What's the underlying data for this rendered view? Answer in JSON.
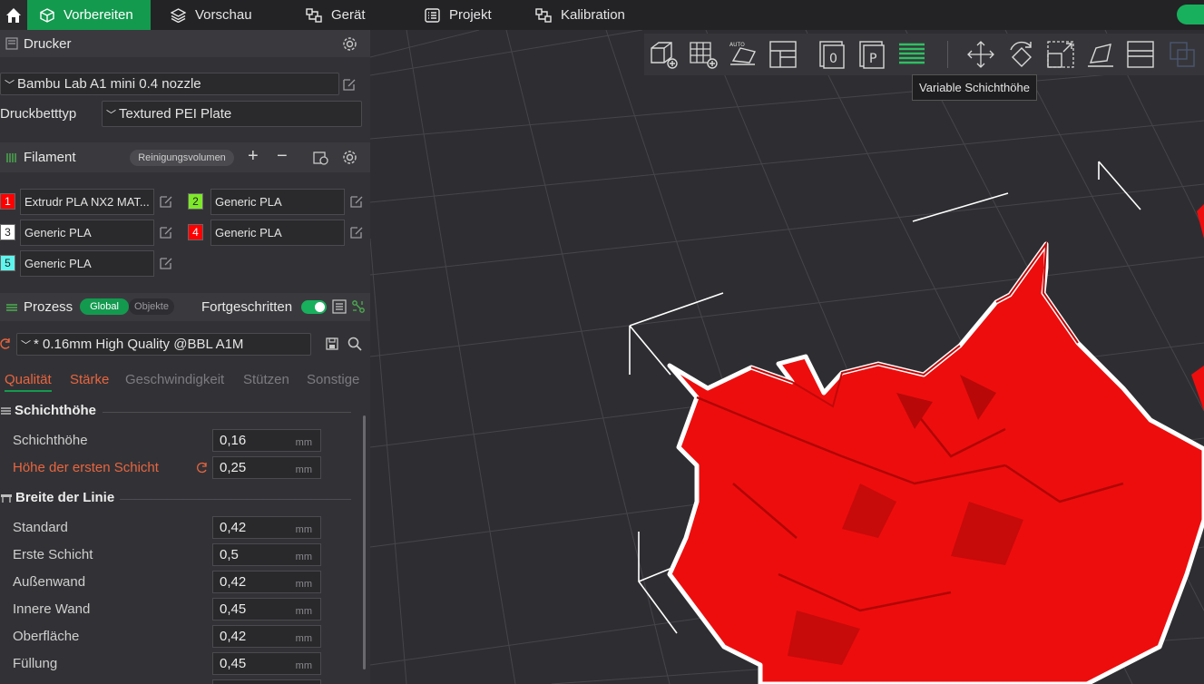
{
  "nav": {
    "tabs": [
      {
        "label": "Vorbereiten"
      },
      {
        "label": "Vorschau"
      },
      {
        "label": "Gerät"
      },
      {
        "label": "Projekt"
      },
      {
        "label": "Kalibration"
      }
    ]
  },
  "printer": {
    "title": "Drucker",
    "model": "Bambu Lab A1 mini 0.4 nozzle",
    "bed_label": "Druckbetttyp",
    "bed_value": "Textured PEI Plate"
  },
  "filament": {
    "title": "Filament",
    "purge_button": "Reinigungsvolumen",
    "add": "+",
    "remove": "−",
    "items": [
      {
        "num": "1",
        "name": "Extrudr PLA NX2 MAT...",
        "color": "#ff0000"
      },
      {
        "num": "2",
        "name": "Generic PLA",
        "color": "#7ee82a"
      },
      {
        "num": "3",
        "name": "Generic PLA",
        "color": "#ffffff"
      },
      {
        "num": "4",
        "name": "Generic PLA",
        "color": "#ff0000"
      },
      {
        "num": "5",
        "name": "Generic PLA",
        "color": "#5ff5ef"
      }
    ]
  },
  "process": {
    "title": "Prozess",
    "global": "Global",
    "objects": "Objekte",
    "advanced_label": "Fortgeschritten",
    "preset": "* 0.16mm High Quality @BBL A1M",
    "tabs": [
      "Qualität",
      "Stärke",
      "Geschwindigkeit",
      "Stützen",
      "Sonstige"
    ],
    "group_layer": "Schichthöhe",
    "layer_height_label": "Schichthöhe",
    "layer_height": "0,16",
    "first_layer_label": "Höhe der ersten Schicht",
    "first_layer": "0,25",
    "group_width": "Breite der Linie",
    "unit": "mm",
    "widths": [
      {
        "label": "Standard",
        "value": "0,42"
      },
      {
        "label": "Erste Schicht",
        "value": "0,5"
      },
      {
        "label": "Außenwand",
        "value": "0,42"
      },
      {
        "label": "Innere Wand",
        "value": "0,45"
      },
      {
        "label": "Oberfläche",
        "value": "0,42"
      },
      {
        "label": "Füllung",
        "value": "0,45"
      }
    ]
  },
  "viewport": {
    "tooltip": "Variable Schichthöhe",
    "model_color": "#ee0d0d"
  }
}
